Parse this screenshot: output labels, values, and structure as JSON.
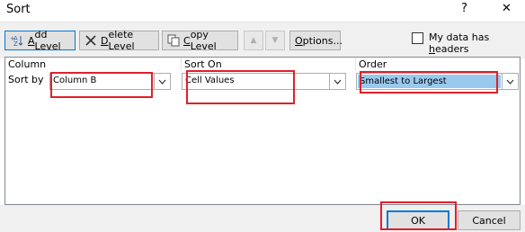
{
  "window": {
    "title": "Sort",
    "help_glyph": "?",
    "close_glyph": "✕"
  },
  "toolbar": {
    "add_level": {
      "underline": "A",
      "rest": "dd Level"
    },
    "delete_level": {
      "underline": "D",
      "rest": "elete Level"
    },
    "copy_level": {
      "underline": "C",
      "rest": "opy Level"
    },
    "move_up_glyph": "▲",
    "move_down_glyph": "▼",
    "options": {
      "underline": "O",
      "rest": "ptions..."
    },
    "headers_checkbox": {
      "label_prefix": "My data has ",
      "label_underline": "h",
      "label_rest": "eaders",
      "checked": false
    }
  },
  "grid": {
    "headers": {
      "column": "Column",
      "sort_on": "Sort On",
      "order": "Order"
    },
    "row": {
      "label": "Sort by",
      "column_value": "Column B",
      "sort_on_value": "Cell Values",
      "order_value": "Smallest to Largest"
    }
  },
  "footer": {
    "ok": "OK",
    "cancel": "Cancel"
  },
  "colors": {
    "highlight_box": "#e0202a",
    "selection": "#99c9ef",
    "accent": "#0078d7"
  }
}
